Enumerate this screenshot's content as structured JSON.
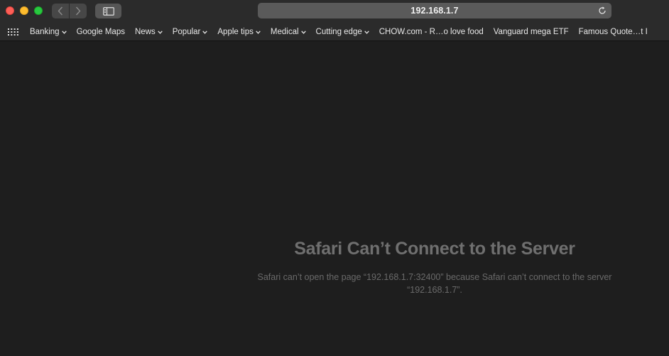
{
  "toolbar": {
    "address": "192.168.1.7"
  },
  "bookmarks": [
    {
      "label": "Banking",
      "folder": true
    },
    {
      "label": "Google Maps",
      "folder": false
    },
    {
      "label": "News",
      "folder": true
    },
    {
      "label": "Popular",
      "folder": true
    },
    {
      "label": "Apple tips",
      "folder": true
    },
    {
      "label": "Medical",
      "folder": true
    },
    {
      "label": "Cutting edge",
      "folder": true
    },
    {
      "label": "CHOW.com - R…o love food",
      "folder": false
    },
    {
      "label": "Vanguard mega ETF",
      "folder": false
    },
    {
      "label": "Famous Quote…t I",
      "folder": false
    }
  ],
  "error": {
    "title": "Safari Can’t Connect to the Server",
    "message": "Safari can’t open the page “192.168.1.7:32400” because Safari can’t connect to the server “192.168.1.7”."
  },
  "colors": {
    "close": "#fe5f57",
    "minimize": "#febc2e",
    "maximize": "#28c840",
    "background": "#1e1e1e",
    "toolbar": "#2b2b2b"
  }
}
